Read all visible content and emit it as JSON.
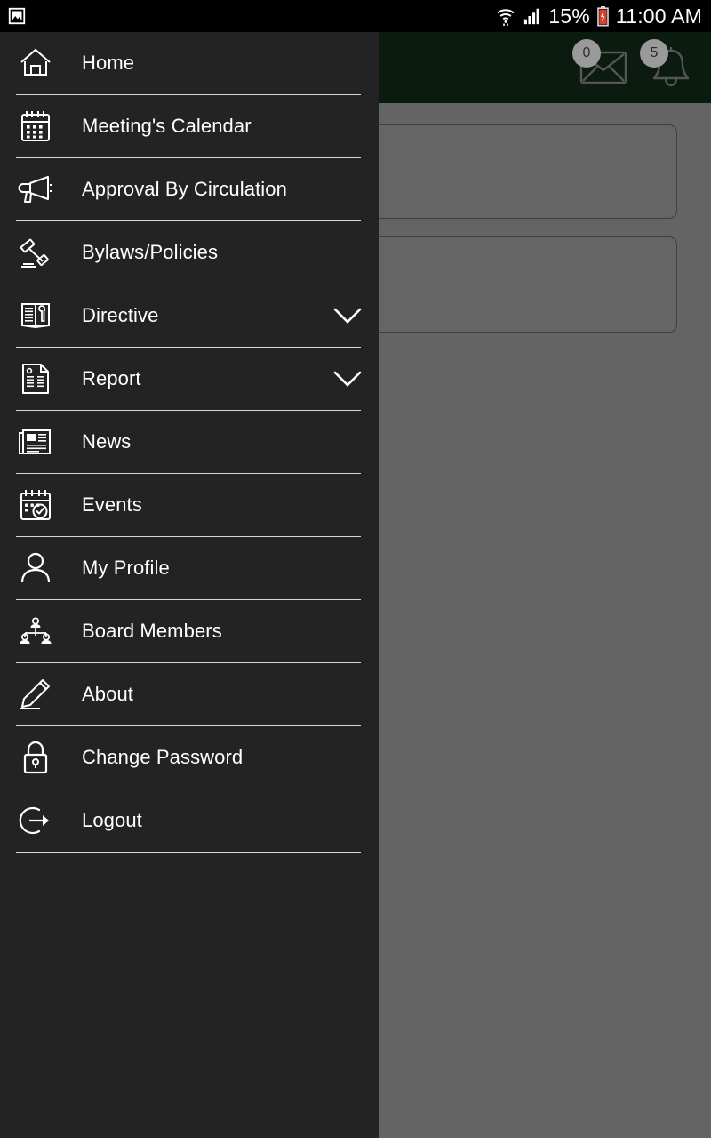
{
  "status_bar": {
    "left_icon": "image-icon",
    "wifi_icon": "wifi-icon",
    "signal_icon": "cellular-signal-icon",
    "battery_percent": "15%",
    "battery_icon": "battery-low-icon",
    "time": "11:00 AM"
  },
  "app_bar": {
    "background_color": "#1e4428",
    "actions": [
      {
        "name": "messages",
        "icon": "envelope-icon",
        "badge": "0"
      },
      {
        "name": "notifications",
        "icon": "bell-icon",
        "badge": "5"
      }
    ]
  },
  "content": {
    "cards": [
      {
        "name": "content-card-1"
      },
      {
        "name": "content-card-2"
      }
    ]
  },
  "drawer": {
    "background_color": "#232323",
    "items": [
      {
        "label": "Home",
        "icon": "home-icon",
        "expandable": false
      },
      {
        "label": "Meeting's Calendar",
        "icon": "calendar-icon",
        "expandable": false
      },
      {
        "label": "Approval By Circulation",
        "icon": "megaphone-icon",
        "expandable": false
      },
      {
        "label": "Bylaws/Policies",
        "icon": "gavel-icon",
        "expandable": false
      },
      {
        "label": "Directive",
        "icon": "book-wrench-icon",
        "expandable": true,
        "chevron": "chevron-down-icon"
      },
      {
        "label": "Report",
        "icon": "report-document-icon",
        "expandable": true,
        "chevron": "chevron-down-icon"
      },
      {
        "label": "News",
        "icon": "newspaper-icon",
        "expandable": false
      },
      {
        "label": "Events",
        "icon": "calendar-check-icon",
        "expandable": false
      },
      {
        "label": "My Profile",
        "icon": "person-icon",
        "expandable": false
      },
      {
        "label": "Board Members",
        "icon": "org-chart-icon",
        "expandable": false
      },
      {
        "label": "About",
        "icon": "pencil-icon",
        "expandable": false
      },
      {
        "label": "Change Password",
        "icon": "lock-icon",
        "expandable": false
      },
      {
        "label": "Logout",
        "icon": "logout-icon",
        "expandable": false
      }
    ]
  }
}
